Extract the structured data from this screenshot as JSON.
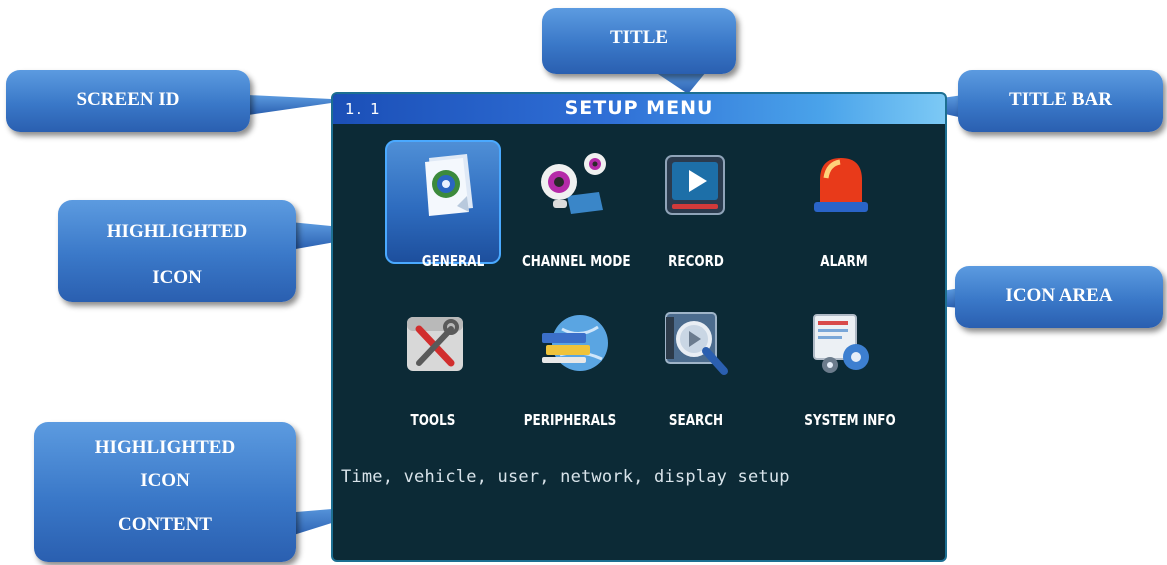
{
  "screen": {
    "id": "1. 1",
    "title": "SETUP  MENU",
    "hint": "Time, vehicle, user, network, display setup",
    "items": [
      {
        "label": "GENERAL",
        "icon": "gear-document-icon",
        "selected": true
      },
      {
        "label": "CHANNEL MODE",
        "icon": "webcam-icon",
        "selected": false
      },
      {
        "label": "RECORD",
        "icon": "play-screen-icon",
        "selected": false
      },
      {
        "label": "ALARM",
        "icon": "siren-icon",
        "selected": false
      },
      {
        "label": "TOOLS",
        "icon": "tools-icon",
        "selected": false
      },
      {
        "label": "PERIPHERALS",
        "icon": "globe-cards-icon",
        "selected": false
      },
      {
        "label": "SEARCH",
        "icon": "magnifier-screen-icon",
        "selected": false
      },
      {
        "label": "SYSTEM INFO",
        "icon": "system-gears-icon",
        "selected": false
      }
    ]
  },
  "callouts": {
    "title": "TITLE",
    "screen_id": "SCREEN ID",
    "title_bar": "TITLE BAR",
    "highlighted_icon": [
      "HIGHLIGHTED",
      "ICON"
    ],
    "icon_area": "ICON AREA",
    "highlighted_icon_content": [
      "HIGHLIGHTED",
      "ICON",
      "CONTENT"
    ]
  },
  "colors": {
    "screen_bg": "#0c2a36",
    "title_bar_start": "#1b4fb7",
    "title_bar_end": "#7cc9f5",
    "callout_blue": "#3a78c8",
    "highlight_blue": "#2e6cbf"
  }
}
